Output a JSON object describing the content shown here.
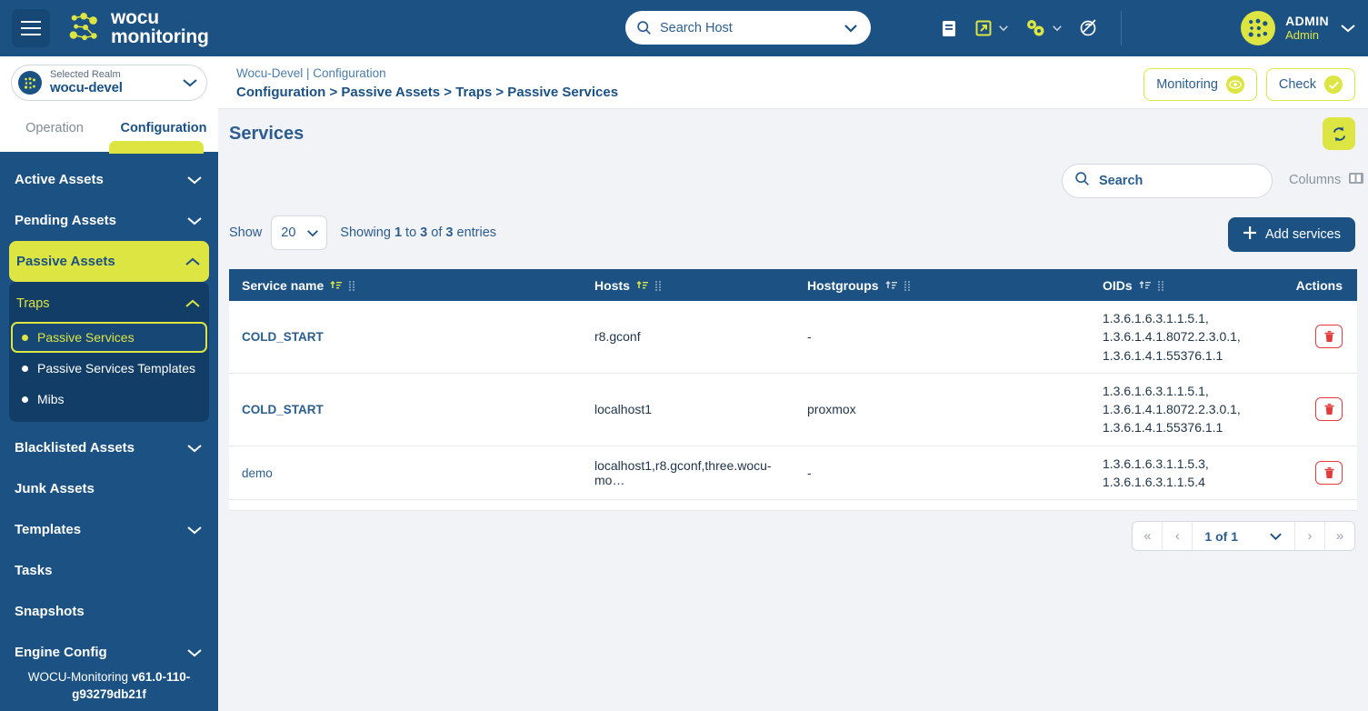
{
  "topbar": {
    "menu_icon": "hamburger-icon",
    "brand_line1": "wocu",
    "brand_line2": "monitoring",
    "search_host_placeholder": "Search Host",
    "search_host_value": "",
    "icons": [
      "document-icon",
      "external-link-icon",
      "gears-icon",
      "satellite-icon"
    ],
    "user_name": "ADMIN",
    "user_role": "Admin"
  },
  "sidebar": {
    "realm_label": "Selected Realm",
    "realm_value": "wocu-devel",
    "tabs": [
      {
        "label": "Operation",
        "active": false
      },
      {
        "label": "Configuration",
        "active": true
      }
    ],
    "items": [
      {
        "label": "Active Assets",
        "expandable": true,
        "expanded": false
      },
      {
        "label": "Pending Assets",
        "expandable": true,
        "expanded": false
      },
      {
        "label": "Passive Assets",
        "expandable": true,
        "expanded": true,
        "accent": true
      },
      {
        "label": "Blacklisted Assets",
        "expandable": true,
        "expanded": false
      },
      {
        "label": "Junk Assets",
        "expandable": false
      },
      {
        "label": "Templates",
        "expandable": true,
        "expanded": false
      },
      {
        "label": "Tasks",
        "expandable": false
      },
      {
        "label": "Snapshots",
        "expandable": false
      },
      {
        "label": "Engine Config",
        "expandable": true,
        "expanded": false
      }
    ],
    "subgroup": {
      "title": "Traps",
      "items": [
        {
          "label": "Passive Services",
          "active": true
        },
        {
          "label": "Passive Services Templates",
          "active": false
        },
        {
          "label": "Mibs",
          "active": false
        }
      ]
    },
    "version_prefix": "WOCU-Monitoring ",
    "version_value": "v61.0-110-g93279db21f"
  },
  "breadcrumb": {
    "top": "Wocu-Devel | Configuration",
    "path": "Configuration > Passive Assets > Traps > Passive Services",
    "monitoring_label": "Monitoring",
    "check_label": "Check"
  },
  "page": {
    "title": "Services",
    "refresh_icon": "refresh-icon"
  },
  "toolbar": {
    "search_placeholder": "Search",
    "search_value": "",
    "columns_label": "Columns",
    "show_label": "Show",
    "page_size": "20",
    "showing_prefix": "Showing ",
    "showing_from": "1",
    "showing_mid": " to ",
    "showing_to": "3",
    "showing_mid2": " of ",
    "showing_total": "3",
    "showing_suffix": " entries",
    "add_label": "Add services"
  },
  "table": {
    "columns": [
      {
        "label": "Service name",
        "sorted": true
      },
      {
        "label": "Hosts",
        "sorted": true
      },
      {
        "label": "Hostgroups",
        "sorted": false
      },
      {
        "label": "OIDs",
        "sorted": false
      },
      {
        "label": "Actions",
        "sorted": false
      }
    ],
    "rows": [
      {
        "service": "COLD_START",
        "service_bold": true,
        "hosts": "r8.gconf",
        "hostgroups": "-",
        "oids": "1.3.6.1.6.3.1.1.5.1, 1.3.6.1.4.1.8072.2.3.0.1, 1.3.6.1.4.1.55376.1.1",
        "action": "delete-icon"
      },
      {
        "service": "COLD_START",
        "service_bold": true,
        "hosts": "localhost1",
        "hostgroups": "proxmox",
        "oids": "1.3.6.1.6.3.1.1.5.1, 1.3.6.1.4.1.8072.2.3.0.1, 1.3.6.1.4.1.55376.1.1",
        "action": "delete-icon"
      },
      {
        "service": "demo",
        "service_bold": false,
        "hosts": "localhost1,r8.gconf,three.wocu-mo…",
        "hostgroups": "-",
        "oids": "1.3.6.1.6.3.1.1.5.3, 1.3.6.1.6.3.1.1.5.4",
        "action": "delete-icon"
      }
    ]
  },
  "pagination": {
    "first": "«",
    "prev": "‹",
    "current": "1 of 1",
    "next": "›",
    "last": "»"
  },
  "colors": {
    "brand_blue": "#1b5183",
    "accent_yellow": "#dde542",
    "link_blue": "#2c5d8f",
    "danger_red": "#e33b3b"
  }
}
